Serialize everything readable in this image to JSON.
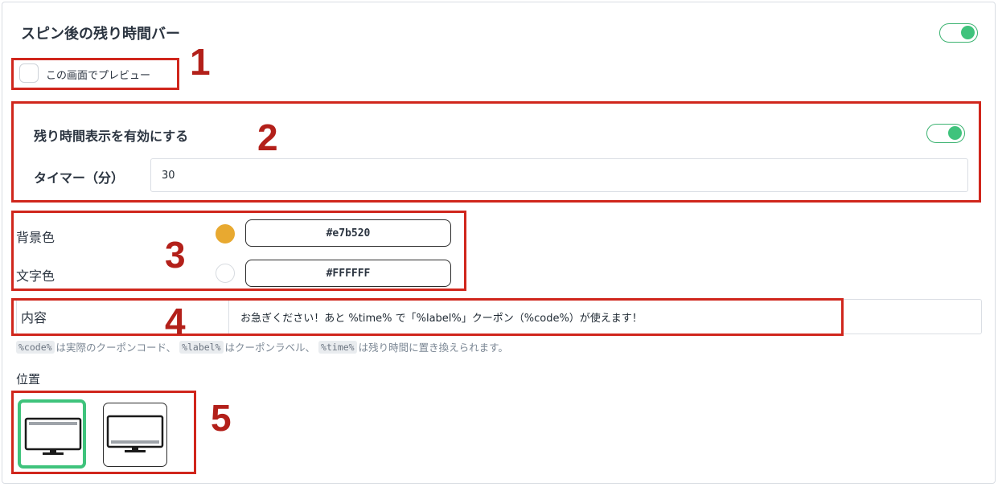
{
  "section": {
    "title": "スピン後の残り時間バー",
    "enabled": true
  },
  "preview": {
    "label": "この画面でプレビュー",
    "checked": false
  },
  "timer": {
    "enable_label": "残り時間表示を有効にする",
    "enabled": true,
    "minutes_label": "タイマー（分）",
    "minutes_value": "30"
  },
  "colors": {
    "background_label": "背景色",
    "background_value": "#e7b520",
    "background_swatch": "#e8a930",
    "text_label": "文字色",
    "text_value": "#FFFFFF",
    "text_swatch": "#ffffff"
  },
  "content": {
    "label": "内容",
    "value": "お急ぎください！あと %time% で「%label%」クーポン（%code%）が使えます！"
  },
  "help": {
    "code_token": "%code%",
    "code_text": "は実際のクーポンコード、",
    "label_token": "%label%",
    "label_text": "はクーポンラベル、",
    "time_token": "%time%",
    "time_text": "は残り時間に置き換えられます。"
  },
  "position": {
    "label": "位置",
    "options": [
      {
        "name": "top",
        "selected": true
      },
      {
        "name": "bottom",
        "selected": false
      }
    ]
  },
  "annotations": [
    "1",
    "2",
    "3",
    "4",
    "5"
  ],
  "accent_color": "#3fc37c",
  "annotation_color": "#d0261c"
}
